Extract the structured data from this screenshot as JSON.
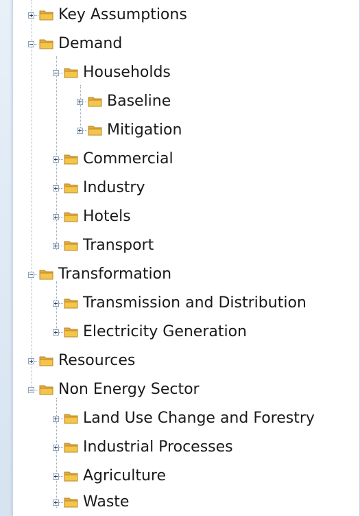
{
  "tree": {
    "items": [
      {
        "label": "Key Assumptions",
        "expanded": false,
        "icon": "folder-icon"
      },
      {
        "label": "Demand",
        "expanded": true,
        "icon": "folder-icon"
      },
      {
        "label": "Households",
        "expanded": true,
        "icon": "folder-icon"
      },
      {
        "label": "Baseline",
        "expanded": false,
        "icon": "folder-icon"
      },
      {
        "label": "Mitigation",
        "expanded": false,
        "icon": "folder-icon"
      },
      {
        "label": "Commercial",
        "expanded": false,
        "icon": "folder-icon"
      },
      {
        "label": "Industry",
        "expanded": false,
        "icon": "folder-icon"
      },
      {
        "label": "Hotels",
        "expanded": false,
        "icon": "folder-icon"
      },
      {
        "label": "Transport",
        "expanded": false,
        "icon": "folder-icon"
      },
      {
        "label": "Transformation",
        "expanded": true,
        "icon": "folder-icon"
      },
      {
        "label": "Transmission and Distribution",
        "expanded": false,
        "icon": "folder-icon"
      },
      {
        "label": "Electricity Generation",
        "expanded": false,
        "icon": "folder-icon"
      },
      {
        "label": "Resources",
        "expanded": false,
        "icon": "folder-icon"
      },
      {
        "label": "Non Energy Sector",
        "expanded": true,
        "icon": "folder-icon"
      },
      {
        "label": "Land Use Change and Forestry",
        "expanded": false,
        "icon": "folder-icon"
      },
      {
        "label": "Industrial Processes",
        "expanded": false,
        "icon": "folder-icon"
      },
      {
        "label": "Agriculture",
        "expanded": false,
        "icon": "folder-icon"
      },
      {
        "label": "Waste",
        "expanded": false,
        "icon": "folder-icon"
      }
    ]
  },
  "colors": {
    "folder_fill": "#f3c64a",
    "folder_tab": "#e6a93a",
    "folder_outline": "#b9862b",
    "text": "#1a1a1a"
  }
}
